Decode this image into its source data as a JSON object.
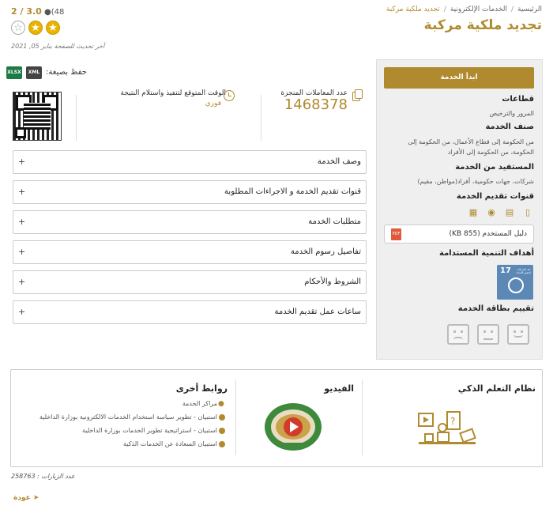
{
  "breadcrumb": {
    "home": "الرئيسية",
    "services": "الخدمات الإلكترونية",
    "current": "تجديد ملكية مركبة"
  },
  "page_title": "تجديد ملكية مركبة",
  "rating": {
    "score": "2 / 3.0",
    "votes": "(48",
    "stars": [
      1,
      1,
      0
    ]
  },
  "updated_text": "آخر تحديث للصفحة يناير 05, 2021",
  "save_as": "حفظ بصيغة:",
  "file_formats": [
    "XLSX",
    "XML"
  ],
  "stats": {
    "eta_label": "الوقت المتوقع لتنفيذ واستلام النتيجة",
    "eta_value": "فوري",
    "transactions_label": "عدد المعاملات المنجزة",
    "transactions_value": "1468378"
  },
  "accordion": [
    "وصف الخدمة",
    "قنوات تقديم الخدمة و الاجراءات المطلوبة",
    "متطلبات الخدمة",
    "تفاصيل رسوم الخدمة",
    "الشروط والأحكام",
    "ساعات عمل تقديم الخدمة"
  ],
  "sidebar": {
    "start_button": "ابدأ الخدمة",
    "sectors_head": "قطاعات",
    "sectors_text": "المرور والترخيص",
    "category_head": "صنف الخدمة",
    "category_text": "من الحكومة إلى قطاع الأعمال، من الحكومة إلى الحكومة، من الحكومة إلى الأفراد",
    "beneficiary_head": "المستفيد من الخدمة",
    "beneficiary_text": "شركات، جهات حكومية، أفراد(مواطن، مقيم)",
    "channels_head": "قنوات تقديم الخدمة",
    "channels_icons": [
      "mobile-icon",
      "laptop-icon",
      "location-icon",
      "kiosk-icon"
    ],
    "guide_label": "دليل المستخدم (855 KB)",
    "sdg_head": "أهداف التنمية المستدامة",
    "sdg_number": "17",
    "sdg_text": "عقد الشراكات لتحقيق الأهداف",
    "card_rating_head": "تقييم بطاقة الخدمة"
  },
  "bottom": {
    "learning_head": "نظام التعلم الذكي",
    "video_head": "الفيديو",
    "links_head": "روابط أخرى",
    "links": [
      "مراكز الخدمة",
      "استبيان - تطوير سياسة استخدام الخدمات الالكترونية بوزارة الداخلية",
      "استبيان - استراتيجية تطوير الخدمات بوزارة الداخلية",
      "استبيان السعادة عن الخدمات الذكية"
    ]
  },
  "visits": "عدد الزيارات : 258763",
  "back_label": "عودة",
  "colors": {
    "accent": "#b08a2e",
    "sidebar_bg": "#efefef",
    "xlsx": "#1e7a45",
    "pdf": "#e05a3a",
    "sdg": "#5b88b5"
  }
}
